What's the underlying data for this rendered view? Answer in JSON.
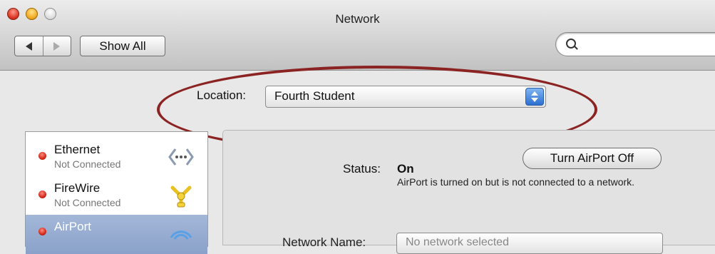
{
  "window": {
    "title": "Network"
  },
  "toolbar": {
    "show_all_label": "Show All",
    "search_placeholder": ""
  },
  "location": {
    "label": "Location:",
    "value": "Fourth Student"
  },
  "services": [
    {
      "name": "Ethernet",
      "status": "Not Connected",
      "icon": "ethernet-icon"
    },
    {
      "name": "FireWire",
      "status": "Not Connected",
      "icon": "firewire-icon"
    },
    {
      "name": "AirPort",
      "status": "",
      "icon": "airport-icon",
      "selected": true
    }
  ],
  "detail": {
    "status_label": "Status:",
    "status_value": "On",
    "toggle_button_label": "Turn AirPort Off",
    "status_description": "AirPort is turned on but is not connected to a network.",
    "network_name_label": "Network Name:",
    "network_name_value": "No network selected"
  },
  "colors": {
    "annotation_ellipse": "#8b2323",
    "selection": "#8aa1c9",
    "status_red": "#d0281a"
  }
}
